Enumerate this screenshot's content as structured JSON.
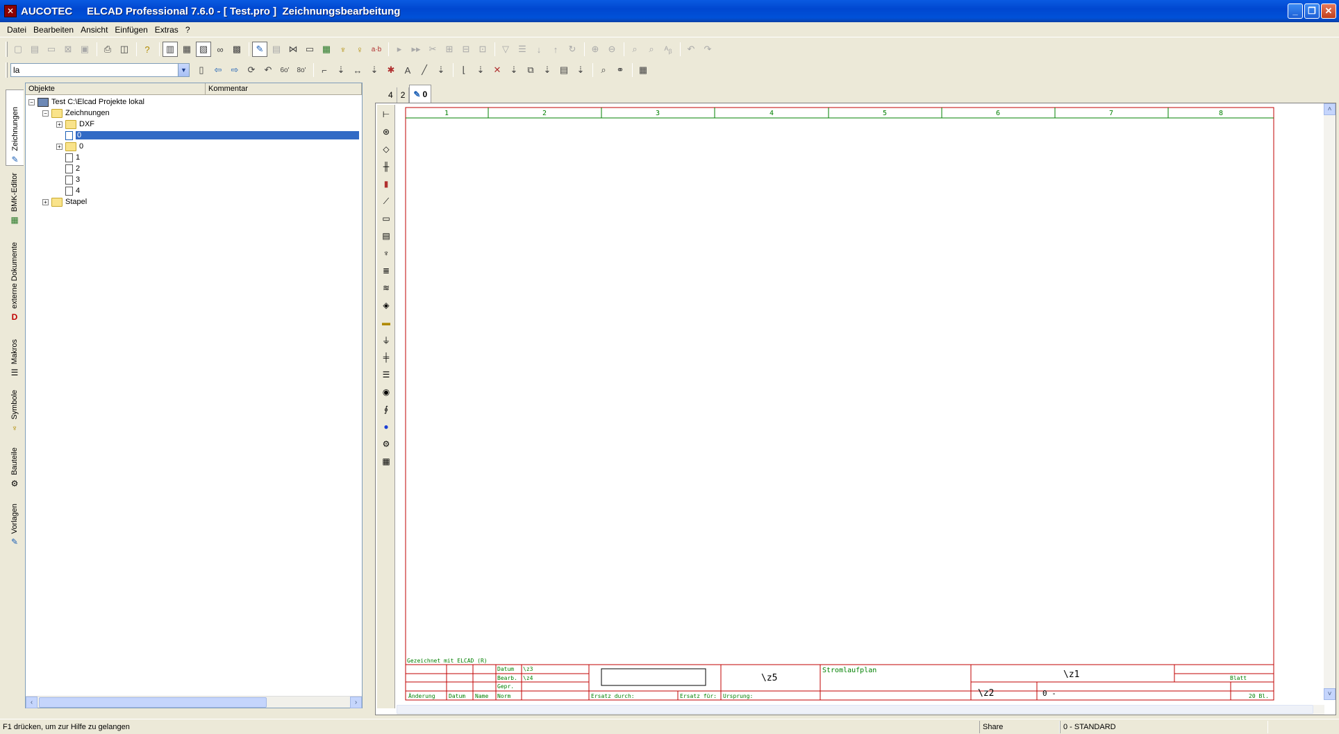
{
  "window": {
    "title": "AUCOTEC     ELCAD Professional 7.6.0 - [ Test.pro ]  Zeichnungsbearbeitung"
  },
  "menu": [
    "Datei",
    "Bearbeiten",
    "Ansicht",
    "Einfügen",
    "Extras",
    "?"
  ],
  "toolbar2": {
    "combo_value": "la"
  },
  "sidebar_tabs": [
    "Zeichnungen",
    "BMK-Editor",
    "externe Dokumente",
    "Makros",
    "Symbole",
    "Bauteile",
    "Vorlagen"
  ],
  "tree": {
    "col_objects": "Objekte",
    "col_comment": "Kommentar",
    "root": "Test C:\\Elcad Projekte lokal",
    "zeichnungen": "Zeichnungen",
    "dxf": "DXF",
    "item_selected": "0",
    "folder0": "0",
    "d1": "1",
    "d2": "2",
    "d3": "3",
    "d4": "4",
    "stapel": "Stapel"
  },
  "doc_tabs": [
    "4",
    "2",
    "0"
  ],
  "sheet": {
    "columns": [
      "1",
      "2",
      "3",
      "4",
      "5",
      "6",
      "7",
      "8"
    ],
    "drawn_with": "Gezeichnet mit ELCAD (R)",
    "datum": "Datum",
    "z3": "\\z3",
    "bearb": "Bearb.",
    "z4": "\\z4",
    "gepr": "Gepr.",
    "norm": "Norm",
    "aenderung": "Änderung",
    "datum2": "Datum",
    "name": "Name",
    "ersatz_durch": "Ersatz durch:",
    "ersatz_fuer": "Ersatz für:",
    "ursprung": "Ursprung:",
    "z5": "\\z5",
    "stromlaufplan": "Stromlaufplan",
    "z1": "\\z1",
    "z2": "\\z2",
    "zero": "0 -",
    "blatt": "Blatt",
    "bl": "20 Bl."
  },
  "status": {
    "help": "F1 drücken, um zur Hilfe zu gelangen",
    "share": "Share",
    "layer": "0 - STANDARD"
  }
}
